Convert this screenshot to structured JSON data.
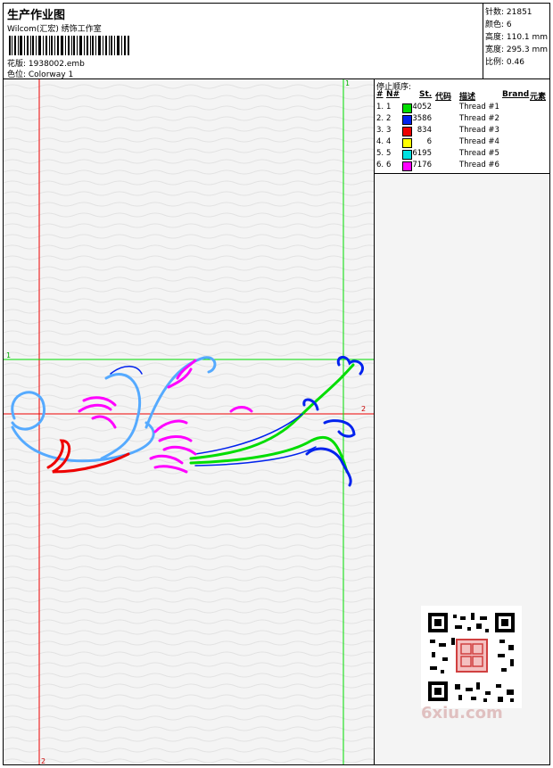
{
  "header": {
    "title": "生产作业图",
    "subtitle": "Wilcom(汇宏) 绣饰工作室",
    "design_label": "花版: 1938002.emb",
    "colorway_label": "色位:  Colorway 1"
  },
  "stats": {
    "stitches": "针数: 21851",
    "colors": "颜色: 6",
    "height": "高度: 110.1 mm",
    "width": "宽度: 295.3 mm",
    "scale": "比例: 0.46"
  },
  "guides": {
    "v1": "1",
    "h1": "1",
    "v2": "2",
    "h2": "2"
  },
  "stop_sequence": {
    "title": "停止顺序:",
    "headers": {
      "num": "#",
      "n": "N#",
      "st": "St.",
      "code": "代码",
      "desc": "描述",
      "brand": "Brand",
      "element": "元素"
    },
    "rows": [
      {
        "idx": "1.",
        "n": "1",
        "color": "#00dd00",
        "st": "4052",
        "desc": "Thread #1"
      },
      {
        "idx": "2.",
        "n": "2",
        "color": "#0022ee",
        "st": "3586",
        "desc": "Thread #2"
      },
      {
        "idx": "3.",
        "n": "3",
        "color": "#ee0000",
        "st": "834",
        "desc": "Thread #3"
      },
      {
        "idx": "4.",
        "n": "4",
        "color": "#ffff00",
        "st": "6",
        "desc": "Thread #4"
      },
      {
        "idx": "5.",
        "n": "5",
        "color": "#00e0e0",
        "st": "6195",
        "desc": "Thread #5"
      },
      {
        "idx": "6.",
        "n": "6",
        "color": "#ff00ff",
        "st": "7176",
        "desc": "Thread #6"
      }
    ]
  },
  "watermark": "6xiu.com",
  "colors": {
    "green": "#00dd00",
    "blue": "#0022ee",
    "red": "#ee0000",
    "cyan": "#55aaff",
    "magenta": "#ff00ff"
  }
}
